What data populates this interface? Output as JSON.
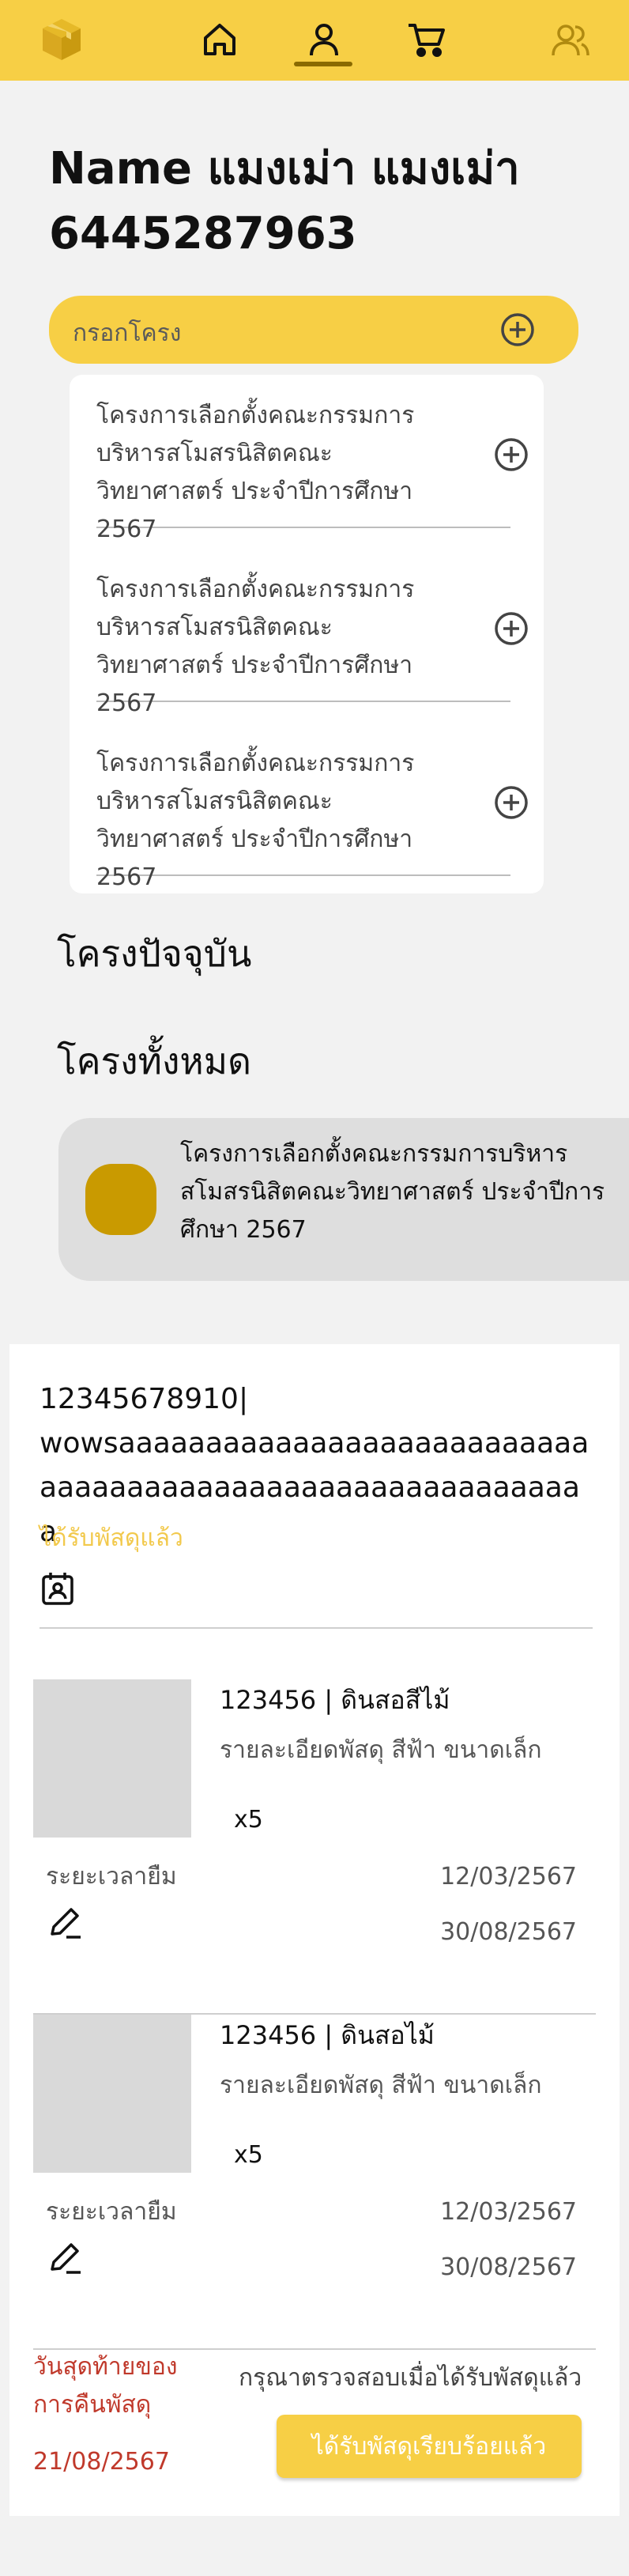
{
  "nav": {
    "logo_icon": "package-box-icon",
    "items": [
      {
        "icon": "home-icon"
      },
      {
        "icon": "user-icon",
        "active": true
      },
      {
        "icon": "cart-icon"
      },
      {
        "icon": "users-icon"
      }
    ]
  },
  "user": {
    "name": "Name แมงเม่า แมงเม่า",
    "id": "6445287963"
  },
  "project_select": {
    "label": "กรอกโครง",
    "options": [
      {
        "label": "โครงการเลือกตั้งคณะกรรมการบริหารสโมสรนิสิตคณะวิทยาศาสตร์ ประจำปีการศึกษา 2567"
      },
      {
        "label": "โครงการเลือกตั้งคณะกรรมการบริหารสโมสรนิสิตคณะวิทยาศาสตร์ ประจำปีการศึกษา 2567"
      },
      {
        "label": "โครงการเลือกตั้งคณะกรรมการบริหารสโมสรนิสิตคณะวิทยาศาสตร์ ประจำปีการศึกษา 2567"
      }
    ]
  },
  "sections": {
    "current": "โครงปัจจุบัน",
    "all": "โครงทั้งหมด"
  },
  "project_card": {
    "title": "โครงการเลือกตั้งคณะกรรมการบริหารสโมสรนิสิตคณะวิทยาศาสตร์ ประจำปีการศึกษา 2567"
  },
  "order": {
    "id_line": "12345678910|",
    "desc_line": "wowsaaaaaaaaaaaaaaaaaaaaaaaaaaaaaaaaaaaaaaaaaaaaaaaaaaaaaaaaaaa",
    "status": "ได้รับพัสดุแล้ว",
    "items": [
      {
        "title": "123456 | ดินสอสีไม้",
        "desc": "รายละเอียดพัสดุ สีฟ้า ขนาดเล็ก",
        "qty": "x5",
        "period_label": "ระยะเวลายืม",
        "start_date": "12/03/2567",
        "end_date": "30/08/2567"
      },
      {
        "title": "123456 | ดินสอไม้",
        "desc": "รายละเอียดพัสดุ สีฟ้า ขนาดเล็ก",
        "qty": "x5",
        "period_label": "ระยะเวลายืม",
        "start_date": "12/03/2567",
        "end_date": "30/08/2567"
      }
    ],
    "return_label": "วันสุดท้ายของการคืนพัสดุ",
    "return_date": "21/08/2567",
    "check_text": "กรุณาตรวจสอบเมื่อได้รับพัสดุแล้ว",
    "confirm_button": "ได้รับพัสดุเรียบร้อยแล้ว"
  },
  "colors": {
    "brand": "#f7cf45",
    "accent_dark": "#8a6a00",
    "warning": "#c0392b"
  }
}
